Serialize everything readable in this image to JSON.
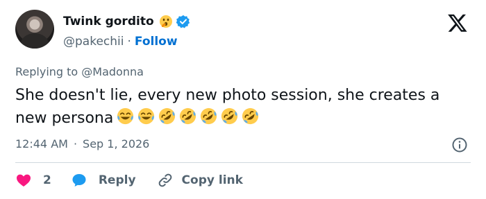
{
  "user": {
    "display_name": "Twink gordito",
    "handle": "@pakechii",
    "separator": "·",
    "follow_label": "Follow",
    "badge_emoji": "face-with-open-eyes-and-hand-over-mouth",
    "verified_color": "#1d9bf0"
  },
  "reply": {
    "text": "Replying to @Madonna"
  },
  "tweet": {
    "text": "She doesn't lie, every new photo session, she creates a new persona",
    "emojis": [
      "face-with-tears-of-joy",
      "face-with-tears-of-joy",
      "rolling-on-the-floor-laughing",
      "rolling-on-the-floor-laughing",
      "rolling-on-the-floor-laughing",
      "rolling-on-the-floor-laughing",
      "rolling-on-the-floor-laughing"
    ]
  },
  "meta": {
    "time": "12:44 AM",
    "separator": "·",
    "date": "Sep 1, 2026"
  },
  "actions": {
    "like_count": "2",
    "reply_label": "Reply",
    "copy_label": "Copy link"
  },
  "colors": {
    "text": "#0f1419",
    "muted": "#536471",
    "link": "#0070d2",
    "like": "#f91880",
    "reply_bubble": "#1d9bf0",
    "divider": "#cfd9de"
  }
}
